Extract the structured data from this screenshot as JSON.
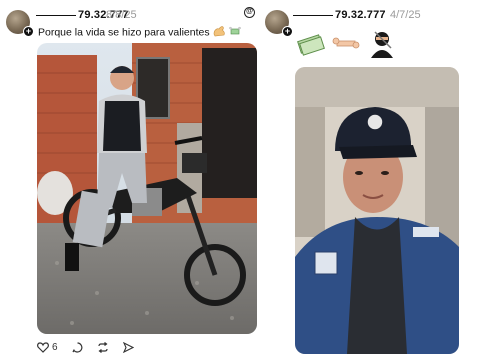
{
  "left_post": {
    "username": "79.32.777",
    "date": "8/8/25",
    "text": "Porque la vida se hizo para valientes",
    "like_count": "6"
  },
  "right_post": {
    "username": "79.32.777",
    "date": "4/7/25"
  },
  "icons": {
    "left_emojis": [
      "flexed-biceps",
      "money-with-wings"
    ],
    "right_emojis": [
      "money-stack",
      "bone-item",
      "ninja"
    ],
    "actions": [
      "heart-icon",
      "comment-icon",
      "repost-icon",
      "share-icon"
    ]
  },
  "colors": {
    "text": "#111111",
    "date": "#9a9a9a",
    "background": "#ffffff"
  }
}
